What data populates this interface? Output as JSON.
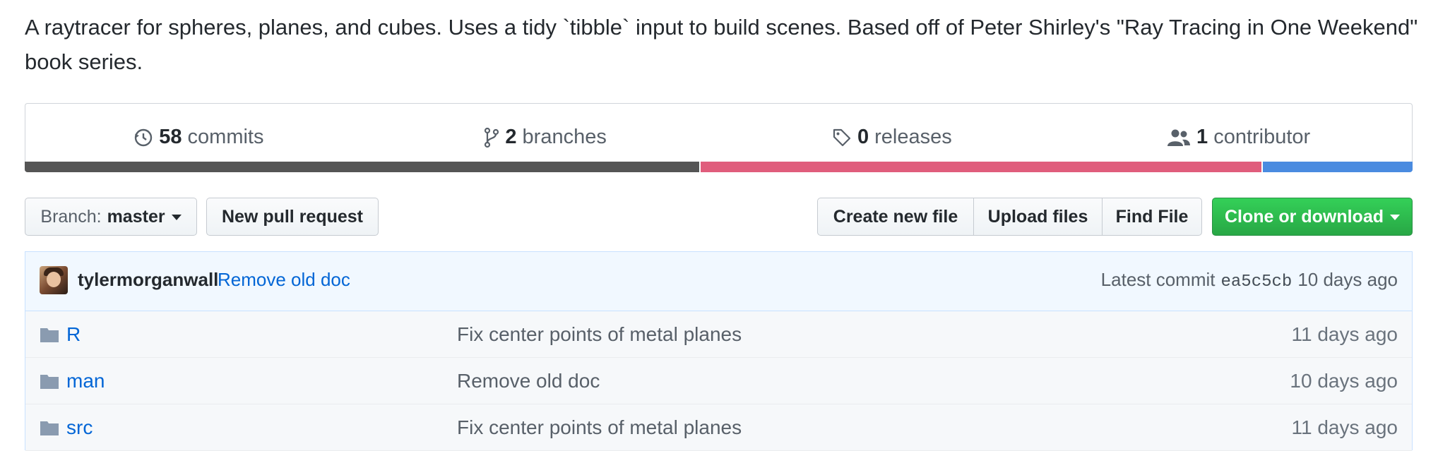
{
  "description": "A raytracer for spheres, planes, and cubes. Uses a tidy `tibble` input to build scenes. Based off of Peter Shirley's \"Ray Tracing in One Weekend\" book series.",
  "summary": {
    "commits_count": "58",
    "commits_label": "commits",
    "branches_count": "2",
    "branches_label": "branches",
    "releases_count": "0",
    "releases_label": "releases",
    "contributors_count": "1",
    "contributors_label": "contributor"
  },
  "language_bar": [
    {
      "color": "#555555",
      "fraction": 0.487
    },
    {
      "color": "#e05d7c",
      "fraction": 0.405
    },
    {
      "color": "#4a8be0",
      "fraction": 0.108
    }
  ],
  "toolbar": {
    "branch_prefix": "Branch:",
    "branch_name": "master",
    "new_pr_label": "New pull request",
    "create_file_label": "Create new file",
    "upload_files_label": "Upload files",
    "find_file_label": "Find File",
    "clone_label": "Clone or download"
  },
  "latest_commit": {
    "author": "tylermorganwall",
    "message": "Remove old doc",
    "prefix": "Latest commit",
    "sha": "ea5c5cb",
    "age": "10 days ago"
  },
  "files": [
    {
      "name": "R",
      "message": "Fix center points of metal planes",
      "age": "11 days ago",
      "icon": "folder-icon"
    },
    {
      "name": "man",
      "message": "Remove old doc",
      "age": "10 days ago",
      "icon": "folder-icon"
    },
    {
      "name": "src",
      "message": "Fix center points of metal planes",
      "age": "11 days ago",
      "icon": "folder-icon"
    }
  ],
  "colors": {
    "link": "#0366d6",
    "clone_green": "#28a745"
  }
}
